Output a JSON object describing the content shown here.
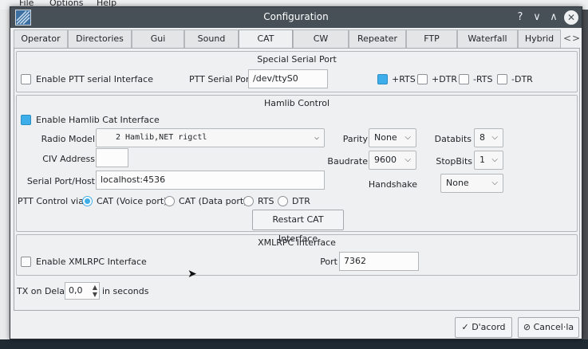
{
  "app_menu": {
    "file": "File",
    "options": "Options",
    "help": "Help"
  },
  "window": {
    "title": "Configuration",
    "help_glyph": "?",
    "minimize_glyph": "∨",
    "maximize_glyph": "∧",
    "close_glyph": "✕"
  },
  "tabs": [
    {
      "label": "Operator"
    },
    {
      "label": "Directories"
    },
    {
      "label": "Gui"
    },
    {
      "label": "Sound"
    },
    {
      "label": "CAT"
    },
    {
      "label": "CW"
    },
    {
      "label": "Repeater"
    },
    {
      "label": "FTP"
    },
    {
      "label": "Waterfall"
    },
    {
      "label": "Hybrid"
    }
  ],
  "tab_scroll": {
    "left": "<",
    "right": ">"
  },
  "special_serial": {
    "title": "Special Serial Port",
    "enable_ptt_label": "Enable PTT serial Interface",
    "ptt_port_label": "PTT Serial Port",
    "ptt_port_value": "/dev/ttyS0",
    "rts_plus": "+RTS",
    "dtr_plus": "+DTR",
    "rts_minus": "-RTS",
    "dtr_minus": "-DTR"
  },
  "hamlib": {
    "title": "Hamlib Control",
    "enable_label": "Enable Hamlib Cat Interface",
    "radio_model_label": "Radio Model",
    "radio_model_value": "2 Hamlib,NET rigctl",
    "civ_label": "CIV Address",
    "civ_value": "",
    "serial_port_label": "Serial Port/Host",
    "serial_port_value": "localhost:4536",
    "parity_label": "Parity",
    "parity_value": "None",
    "baudrate_label": "Baudrate",
    "baudrate_value": "9600",
    "handshake_label": "Handshake",
    "handshake_value": "None",
    "databits_label": "Databits",
    "databits_value": "8",
    "stopbits_label": "StopBits",
    "stopbits_value": "1",
    "ptt_control_label": "PTT Control via:",
    "ptt_options": [
      "CAT (Voice port)",
      "CAT (Data port)",
      "RTS",
      "DTR"
    ],
    "restart_label": "Restart CAT Interface"
  },
  "xmlrpc": {
    "title": "XMLRPC Interface",
    "enable_label": "Enable XMLRPC Interface",
    "port_label": "Port",
    "port_value": "7362"
  },
  "tx_delay": {
    "label": "TX on Delay",
    "value": "0,0",
    "suffix": "in seconds"
  },
  "footer": {
    "ok_label": "D'acord",
    "cancel_label": "Cancel·la",
    "ok_glyph": "✓",
    "cancel_glyph": "⊘"
  }
}
